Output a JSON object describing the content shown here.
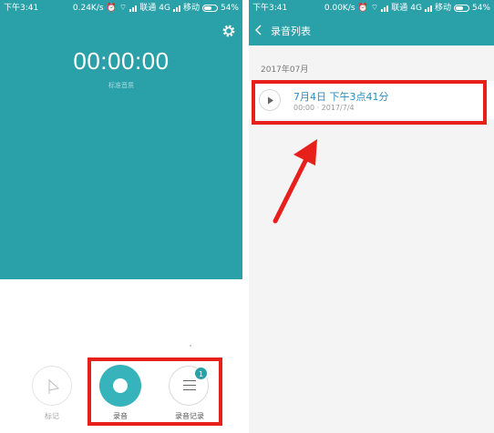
{
  "left_screen": {
    "status": {
      "time": "下午3:41",
      "speed": "0.24K/s",
      "carrier1": "联通",
      "network": "4G",
      "carrier2": "移动",
      "battery": "54%"
    },
    "timer": "00:00:00",
    "quality": "标准音质",
    "controls": {
      "mark_label": "标记",
      "record_label": "录音",
      "list_label": "录音记录",
      "badge_count": "1"
    },
    "icons": [
      "gear-icon",
      "flag-icon",
      "record-icon",
      "list-icon"
    ],
    "colors": {
      "accent": "#2aa0a8",
      "highlight": "#e8201c"
    }
  },
  "right_screen": {
    "status": {
      "time": "下午3:41",
      "speed": "0.00K/s",
      "carrier1": "联通",
      "network": "4G",
      "carrier2": "移动",
      "battery": "54%"
    },
    "title": "录音列表",
    "month": "2017年07月",
    "recording": {
      "title": "7月4日 下午3点41分",
      "meta": "00:00 · 2017/7/4"
    },
    "icons": [
      "back-icon",
      "play-icon"
    ]
  }
}
